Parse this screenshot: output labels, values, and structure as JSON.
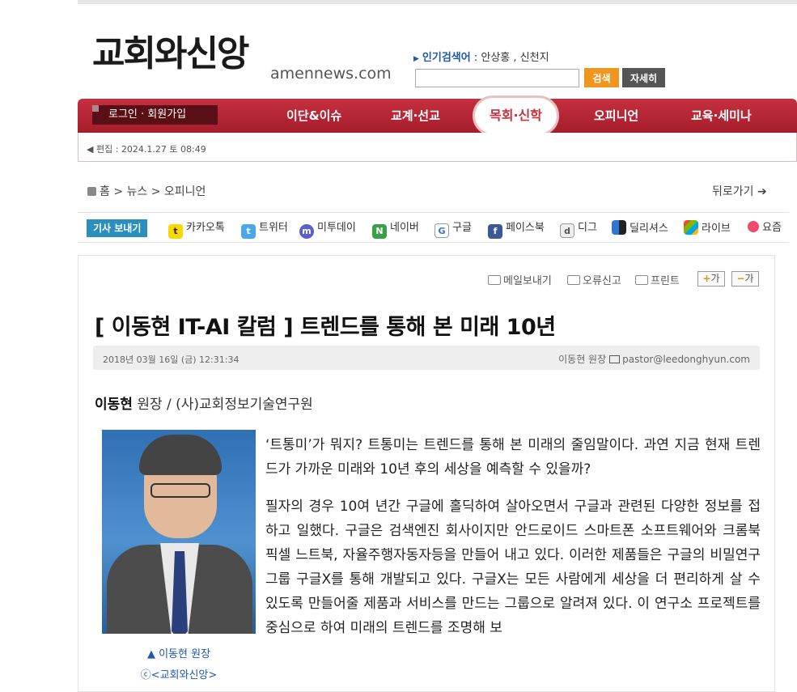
{
  "header": {
    "logo_main": "교회와신앙",
    "logo_sub": "amennews.com",
    "popular_label": "인기검색어",
    "popular_terms": ": 안상홍 , 신천지",
    "search_button": "검색",
    "detail_button": "자세히"
  },
  "nav": {
    "login": "로그인 · 회원가입",
    "items": [
      "이단&이슈",
      "교계·선교",
      "목회·신학",
      "오피니언",
      "교육·세미나"
    ],
    "edit_info": "편집 : 2024.1.27 토 08:49"
  },
  "breadcrumb": {
    "path": "홈 > 뉴스 > 오피니언",
    "back": "뒤로가기"
  },
  "share": {
    "label": "기사 보내기",
    "items": [
      "카카오톡",
      "트위터",
      "미투데이",
      "네이버",
      "구글",
      "페이스북",
      "디그",
      "딜리셔스",
      "라이브",
      "요즘"
    ]
  },
  "tools": {
    "email": "메일보내기",
    "report": "오류신고",
    "print": "프린트",
    "font_plus": "가",
    "font_minus": "가"
  },
  "article": {
    "headline": "[ 이동현 IT-AI 칼럼 ] 트렌드를 통해 본 미래 10년",
    "date": "2018년 03월 16일 (금) 12:31:34",
    "author": "이동현 원장",
    "email": "pastor@leedonghyun.com",
    "byline_name": "이동현",
    "byline_rest": " 원장 / (사)교회정보기술연구원",
    "caption_line1": "▲ 이동현 원장",
    "caption_line2": "ⓒ<교회와신앙>",
    "paragraphs": [
      "‘트통미’가 뭐지? 트통미는 트렌드를 통해 본 미래의 줄임말이다. 과연 지금 현재 트렌드가 가까운 미래와 10년 후의 세상을 예측할 수 있을까?",
      "필자의 경우 10여 년간 구글에 홀딕하여 살아오면서 구글과 관련된 다양한 정보를 접하고 일했다. 구글은 검색엔진 회사이지만 안드로이드 스마트폰 소프트웨어와 크롬북 픽셀 느트북, 자율주행자동자등을 만들어 내고 있다. 이러한 제품들은 구글의 비밀연구그룹 구글X를 통해 개발되고 있다. 구글X는 모든 사람에게 세상을 더 편리하게 살 수 있도록 만들어줄 제품과 서비스를 만드는 그룹으로 알려져 있다. 이 연구소 프로젝트를 중심으로 하여 미래의 트렌드를 조명해 보"
    ]
  },
  "colors": {
    "nav_red": "#b8283a",
    "accent_blue": "#1f5aa6",
    "search_orange": "#f0961e"
  }
}
